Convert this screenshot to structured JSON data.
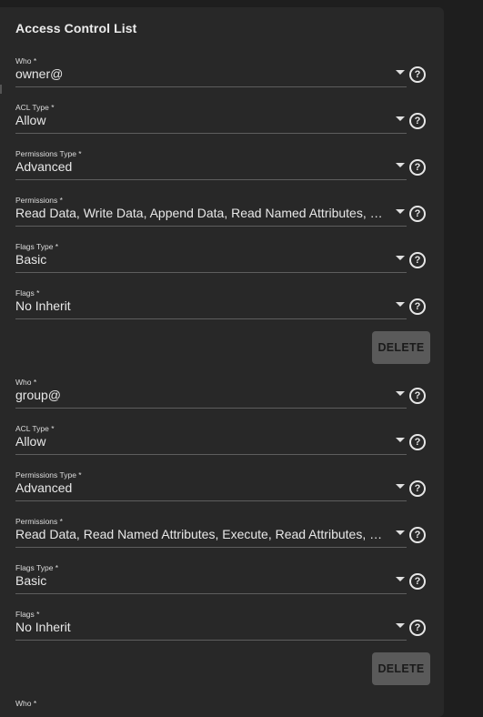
{
  "title": "Access Control List",
  "entries": [
    {
      "who": {
        "label": "Who *",
        "value": "owner@"
      },
      "acl_type": {
        "label": "ACL Type *",
        "value": "Allow"
      },
      "perm_type": {
        "label": "Permissions Type *",
        "value": "Advanced"
      },
      "permissions": {
        "label": "Permissions *",
        "value": "Read Data, Write Data, Append Data, Read Named Attributes, Wri..."
      },
      "flags_type": {
        "label": "Flags Type *",
        "value": "Basic"
      },
      "flags": {
        "label": "Flags *",
        "value": "No Inherit"
      },
      "delete_label": "DELETE"
    },
    {
      "who": {
        "label": "Who *",
        "value": "group@"
      },
      "acl_type": {
        "label": "ACL Type *",
        "value": "Allow"
      },
      "perm_type": {
        "label": "Permissions Type *",
        "value": "Advanced"
      },
      "permissions": {
        "label": "Permissions *",
        "value": "Read Data, Read Named Attributes, Execute, Read Attributes, Rea..."
      },
      "flags_type": {
        "label": "Flags Type *",
        "value": "Basic"
      },
      "flags": {
        "label": "Flags *",
        "value": "No Inherit"
      },
      "delete_label": "DELETE"
    }
  ],
  "next_entry_label": "Who *",
  "help_glyph": "?",
  "icons": {
    "dropdown": "chevron-down-icon",
    "help": "help-circle-icon"
  }
}
